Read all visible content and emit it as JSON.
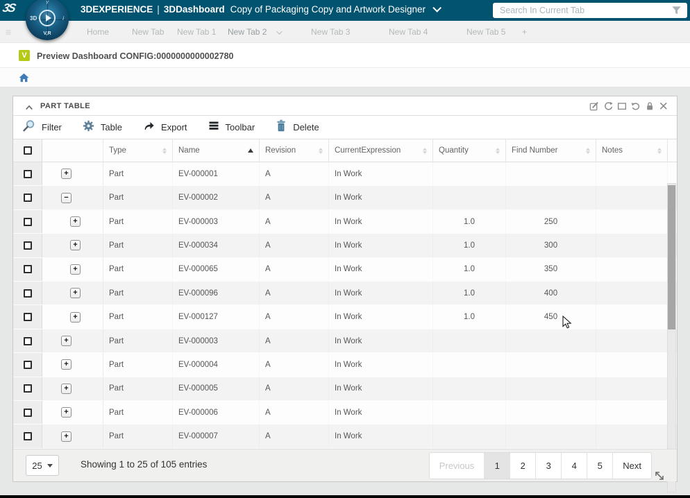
{
  "colors": {
    "topbar_bg": "#01536f",
    "accent_blue": "#3f7cb6",
    "preview_green": "#b5c917",
    "steel_icon": "#54809c"
  },
  "topbar": {
    "brand": "3DEXPERIENCE",
    "separator": "|",
    "app": "3DDashboard",
    "dashboard_title": "Copy of Packaging Copy and Artwork Designer",
    "search_placeholder": "Search In Current Tab"
  },
  "compass": {
    "left_label": "3D",
    "bottom_label": "V,R",
    "top_label": "Y",
    "right_label": "i"
  },
  "tabbar": {
    "tabs": [
      {
        "label": "Home",
        "active": false
      },
      {
        "label": "New Tab",
        "active": false
      },
      {
        "label": "New Tab 1",
        "active": false
      },
      {
        "label": "New Tab 2",
        "active": true
      },
      {
        "label": "New Tab 3",
        "active": false
      },
      {
        "label": "New Tab 4",
        "active": false
      },
      {
        "label": "New Tab 5",
        "active": false
      },
      {
        "label": "+",
        "active": false
      }
    ]
  },
  "preview": {
    "icon_letter": "V",
    "label": "Preview Dashboard CONFIG:0000000000002780"
  },
  "widget": {
    "title": "PART TABLE",
    "header_icons": [
      "edit",
      "refresh",
      "maximize",
      "undo",
      "lock",
      "close"
    ],
    "toolbar": [
      {
        "label": "Filter"
      },
      {
        "label": "Table"
      },
      {
        "label": "Export"
      },
      {
        "label": "Toolbar"
      },
      {
        "label": "Delete"
      }
    ],
    "table": {
      "columns": [
        {
          "label": "Type",
          "sort": "none"
        },
        {
          "label": "Name",
          "sort": "asc"
        },
        {
          "label": "Revision",
          "sort": "none"
        },
        {
          "label": "CurrentExpression",
          "sort": "none"
        },
        {
          "label": "Quantity",
          "sort": "none"
        },
        {
          "label": "Find Number",
          "sort": "none"
        },
        {
          "label": "Notes",
          "sort": "none"
        }
      ],
      "rows": [
        {
          "type": "Part",
          "name": "EV-000001",
          "revision": "A",
          "current_expression": "In Work",
          "quantity": "",
          "find_number": "",
          "notes": "",
          "level": 0,
          "expand": "+"
        },
        {
          "type": "Part",
          "name": "EV-000002",
          "revision": "A",
          "current_expression": "In Work",
          "quantity": "",
          "find_number": "",
          "notes": "",
          "level": 0,
          "expand": "−"
        },
        {
          "type": "Part",
          "name": "EV-000003",
          "revision": "A",
          "current_expression": "In Work",
          "quantity": "1.0",
          "find_number": "250",
          "notes": "",
          "level": 1,
          "expand": "+"
        },
        {
          "type": "Part",
          "name": "EV-000034",
          "revision": "A",
          "current_expression": "In Work",
          "quantity": "1.0",
          "find_number": "300",
          "notes": "",
          "level": 1,
          "expand": "+"
        },
        {
          "type": "Part",
          "name": "EV-000065",
          "revision": "A",
          "current_expression": "In Work",
          "quantity": "1.0",
          "find_number": "350",
          "notes": "",
          "level": 1,
          "expand": "+"
        },
        {
          "type": "Part",
          "name": "EV-000096",
          "revision": "A",
          "current_expression": "In Work",
          "quantity": "1.0",
          "find_number": "400",
          "notes": "",
          "level": 1,
          "expand": "+"
        },
        {
          "type": "Part",
          "name": "EV-000127",
          "revision": "A",
          "current_expression": "In Work",
          "quantity": "1.0",
          "find_number": "450",
          "notes": "",
          "level": 1,
          "expand": "+"
        },
        {
          "type": "Part",
          "name": "EV-000003",
          "revision": "A",
          "current_expression": "In Work",
          "quantity": "",
          "find_number": "",
          "notes": "",
          "level": 0,
          "expand": "+"
        },
        {
          "type": "Part",
          "name": "EV-000004",
          "revision": "A",
          "current_expression": "In Work",
          "quantity": "",
          "find_number": "",
          "notes": "",
          "level": 0,
          "expand": "+"
        },
        {
          "type": "Part",
          "name": "EV-000005",
          "revision": "A",
          "current_expression": "In Work",
          "quantity": "",
          "find_number": "",
          "notes": "",
          "level": 0,
          "expand": "+"
        },
        {
          "type": "Part",
          "name": "EV-000006",
          "revision": "A",
          "current_expression": "In Work",
          "quantity": "",
          "find_number": "",
          "notes": "",
          "level": 0,
          "expand": "+"
        },
        {
          "type": "Part",
          "name": "EV-000007",
          "revision": "A",
          "current_expression": "In Work",
          "quantity": "",
          "find_number": "",
          "notes": "",
          "level": 0,
          "expand": "+"
        }
      ]
    },
    "footer": {
      "page_size": "25",
      "showing_text": "Showing 1 to 25 of 105 entries",
      "pagination": {
        "prev": "Previous",
        "pages": [
          "1",
          "2",
          "3",
          "4",
          "5"
        ],
        "next": "Next",
        "active_page": "1",
        "prev_disabled": true
      }
    }
  }
}
